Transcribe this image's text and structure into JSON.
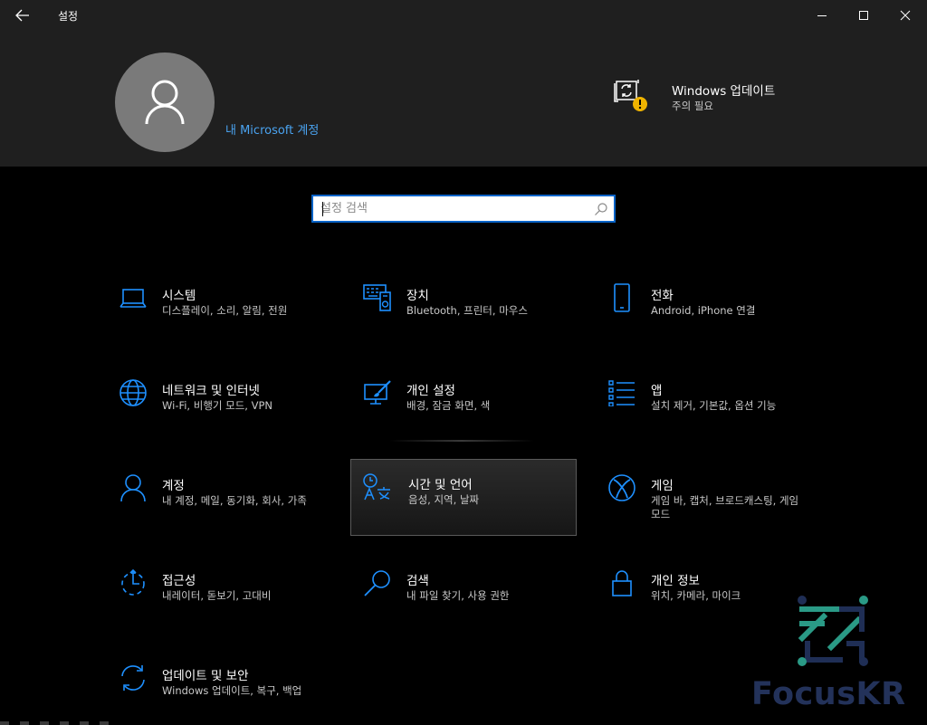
{
  "window": {
    "title": "설정"
  },
  "account": {
    "link_label": "내 Microsoft 계정"
  },
  "update_status": {
    "title": "Windows 업데이트",
    "subtitle": "주의 필요"
  },
  "search": {
    "placeholder": "설정 검색"
  },
  "accent_color": "#0a64c8",
  "categories": [
    {
      "id": "system",
      "label": "시스템",
      "desc": "디스플레이, 소리, 알림, 전원",
      "icon": "laptop-icon"
    },
    {
      "id": "devices",
      "label": "장치",
      "desc": "Bluetooth, 프린터, 마우스",
      "icon": "devices-icon"
    },
    {
      "id": "phone",
      "label": "전화",
      "desc": "Android, iPhone 연결",
      "icon": "phone-icon"
    },
    {
      "id": "network",
      "label": "네트워크 및 인터넷",
      "desc": "Wi-Fi, 비행기 모드, VPN",
      "icon": "globe-icon"
    },
    {
      "id": "personalization",
      "label": "개인 설정",
      "desc": "배경, 잠금 화면, 색",
      "icon": "paint-icon"
    },
    {
      "id": "apps",
      "label": "앱",
      "desc": "설치 제거, 기본값, 옵션 기능",
      "icon": "apps-list-icon"
    },
    {
      "id": "accounts",
      "label": "계정",
      "desc": "내 계정, 메일, 동기화, 회사, 가족",
      "icon": "person-icon"
    },
    {
      "id": "time-language",
      "label": "시간 및 언어",
      "desc": "음성, 지역, 날짜",
      "icon": "time-language-icon"
    },
    {
      "id": "gaming",
      "label": "게임",
      "desc": "게임 바, 캡처, 브로드캐스팅, 게임 모드",
      "icon": "xbox-icon"
    },
    {
      "id": "ease-of-access",
      "label": "접근성",
      "desc": "내레이터, 돋보기, 고대비",
      "icon": "ease-of-access-icon"
    },
    {
      "id": "search",
      "label": "검색",
      "desc": "내 파일 찾기, 사용 권한",
      "icon": "search-icon"
    },
    {
      "id": "privacy",
      "label": "개인 정보",
      "desc": "위치, 카메라, 마이크",
      "icon": "lock-icon"
    },
    {
      "id": "update-security",
      "label": "업데이트 및 보안",
      "desc": "Windows 업데이트, 복구, 백업",
      "icon": "sync-icon"
    }
  ],
  "watermark": {
    "text": "FocusKR"
  }
}
